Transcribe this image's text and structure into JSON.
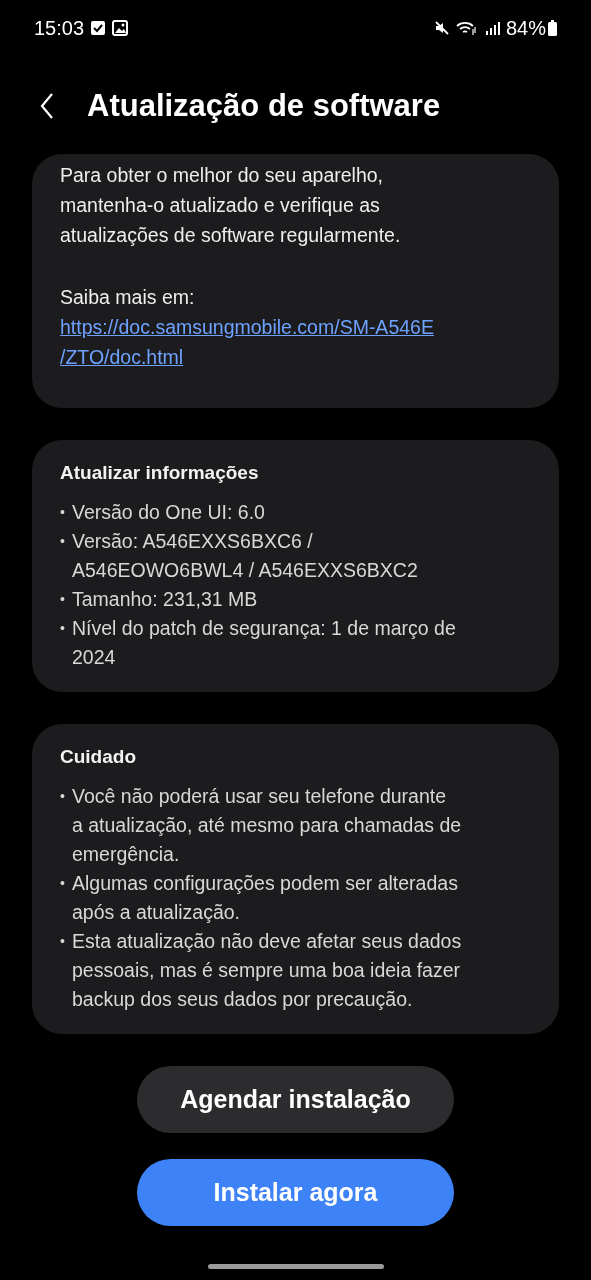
{
  "status_bar": {
    "time": "15:03",
    "battery": "84%"
  },
  "header": {
    "title": "Atualização de software"
  },
  "intro_card": {
    "text": "Para obter o melhor do seu aparelho,\nmantenha-o atualizado e verifique as\natualizações de software regularmente.",
    "more_label": "Saiba mais em:",
    "link": "https://doc.samsungmobile.com/SM-A546E\n/ZTO/doc.html"
  },
  "sections": [
    {
      "title": "Atualizar informações",
      "items": [
        {
          "bullet": "•",
          "text": "Versão do One UI: 6.0"
        },
        {
          "bullet": "•",
          "text": "Versão: A546EXXS6BXC6 /\nA546EOWO6BWL4 / A546EXXS6BXC2"
        },
        {
          "bullet": "•",
          "text": "Tamanho: 231,31 MB"
        },
        {
          "bullet": "•",
          "text": "Nível do patch de segurança: 1 de março de\n2024"
        }
      ]
    },
    {
      "title": "Cuidado",
      "items": [
        {
          "bullet": "•",
          "text": "Você não poderá usar seu telefone durante\na atualização, até mesmo para chamadas de\nemergência."
        },
        {
          "bullet": "•",
          "text": "Algumas configurações podem ser alteradas\napós a atualização."
        },
        {
          "bullet": "•",
          "text": "Esta atualização não deve afetar seus dados\npessoais, mas é sempre uma boa ideia fazer\nbackup dos seus dados por precaução."
        }
      ]
    }
  ],
  "buttons": [
    {
      "label": "Agendar instalação",
      "kind": "secondary"
    },
    {
      "label": "Instalar agora",
      "kind": "primary"
    }
  ]
}
